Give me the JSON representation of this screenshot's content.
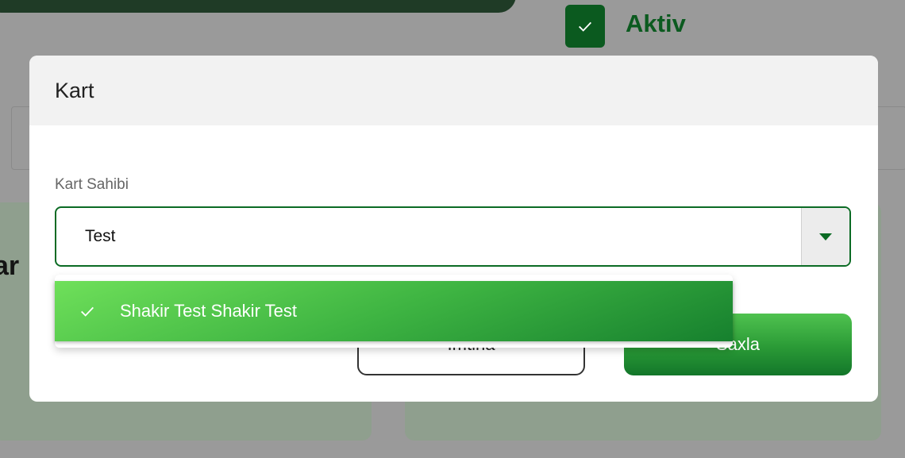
{
  "background": {
    "status_label": "Aktiv",
    "card_text_fragment": "ar"
  },
  "modal": {
    "title": "Kart",
    "field": {
      "label": "Kart Sahibi",
      "value": "Test"
    },
    "buttons": {
      "cancel_label": "İmtina",
      "save_label": "Saxla"
    },
    "dropdown": {
      "options": [
        {
          "label": "Shakir Test Shakir Test",
          "selected": true
        }
      ]
    }
  },
  "colors": {
    "accent": "#0b6b24",
    "selected_option": "#3eb442"
  },
  "icons": {
    "background_checkbox": "checkmark-icon",
    "select_toggle": "caret-down-icon",
    "option_selected": "checkmark-icon"
  }
}
